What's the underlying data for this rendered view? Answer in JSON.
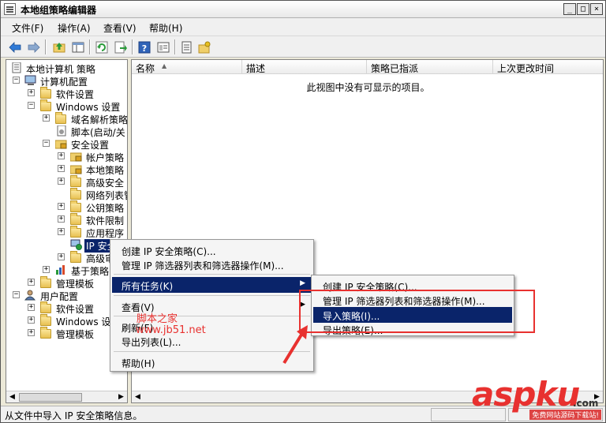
{
  "window": {
    "title": "本地组策略编辑器",
    "controls": {
      "minimize": "_",
      "maximize": "□",
      "close": "×"
    }
  },
  "menubar": [
    {
      "label": "文件(F)"
    },
    {
      "label": "操作(A)"
    },
    {
      "label": "查看(V)"
    },
    {
      "label": "帮助(H)"
    }
  ],
  "toolbar": {
    "icons": [
      "back-icon",
      "forward-icon",
      "up-folder-icon",
      "show-hide-tree-icon",
      "refresh-icon",
      "export-list-icon",
      "help-icon",
      "properties-icon",
      "ip-policy-icon",
      "add-policy-icon"
    ]
  },
  "tree": {
    "nodes": [
      {
        "label": "本地计算机 策略",
        "expander": ""
      },
      {
        "label": "计算机配置",
        "expander": "−"
      },
      {
        "label": "软件设置",
        "expander": "+"
      },
      {
        "label": "Windows 设置",
        "expander": "−"
      },
      {
        "label": "域名解析策略",
        "expander": "+"
      },
      {
        "label": "脚本(启动/关",
        "expander": ""
      },
      {
        "label": "安全设置",
        "expander": "−"
      },
      {
        "label": "帐户策略",
        "expander": "+"
      },
      {
        "label": "本地策略",
        "expander": "+"
      },
      {
        "label": "高级安全",
        "expander": "+"
      },
      {
        "label": "网络列表管",
        "expander": ""
      },
      {
        "label": "公钥策略",
        "expander": "+"
      },
      {
        "label": "软件限制",
        "expander": "+"
      },
      {
        "label": "应用程序",
        "expander": "+"
      },
      {
        "label": "IP 安全策",
        "expander": ""
      },
      {
        "label": "高级审",
        "expander": "+"
      },
      {
        "label": "基于策略",
        "expander": "+"
      },
      {
        "label": "管理模板",
        "expander": "+"
      },
      {
        "label": "用户配置",
        "expander": "−"
      },
      {
        "label": "软件设置",
        "expander": "+"
      },
      {
        "label": "Windows 设置",
        "expander": "+"
      },
      {
        "label": "管理模板",
        "expander": "+"
      }
    ],
    "scroll_left": "◀",
    "scroll_right": "▶"
  },
  "list": {
    "columns": [
      "名称",
      "描述",
      "策略已指派",
      "上次更改时间"
    ],
    "sort_indicator": "▲",
    "empty_message": "此视图中没有可显示的项目。",
    "scroll_left": "◀",
    "scroll_right": "▶"
  },
  "context_menu": {
    "items": [
      {
        "label": "创建 IP 安全策略(C)..."
      },
      {
        "label": "管理 IP 筛选器列表和筛选器操作(M)..."
      },
      {
        "label": "所有任务(K)"
      },
      {
        "label": "查看(V)"
      },
      {
        "label": "刷新(F)"
      },
      {
        "label": "导出列表(L)..."
      },
      {
        "label": "帮助(H)"
      }
    ],
    "submenu_arrow": "▶"
  },
  "submenu": {
    "items": [
      {
        "label": "创建 IP 安全策略(C)..."
      },
      {
        "label": "管理 IP 筛选器列表和筛选器操作(M)..."
      },
      {
        "label": "导入策略(I)..."
      },
      {
        "label": "导出策略(E)..."
      }
    ]
  },
  "status": {
    "text": "从文件中导入 IP 安全策略信息。"
  },
  "watermark": {
    "line1": "脚本之家",
    "line2": "www.jb51.net"
  },
  "brand": {
    "name": "aspku",
    "dot_com": ".com",
    "tagline": "免费网站源码下载站!"
  },
  "colors": {
    "selection": "#0a246a",
    "annotation_red": "#e8312f"
  }
}
